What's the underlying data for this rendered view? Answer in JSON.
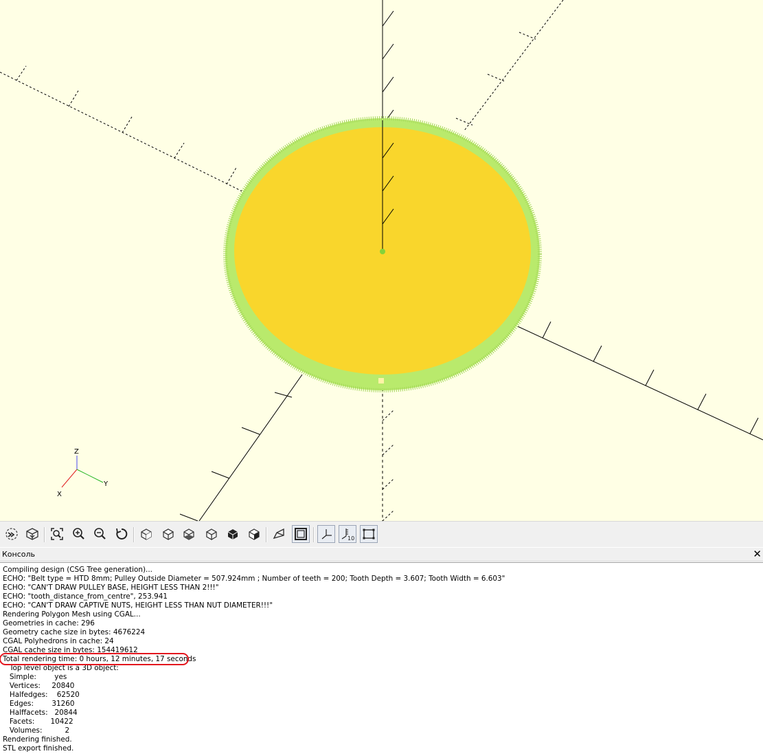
{
  "view": {
    "background": "#ffffe5",
    "model_top_color": "#f9d62c",
    "model_edge_color": "#b9ea6c",
    "axis_color": "#000000",
    "axes_gizmo": {
      "z_label": "Z",
      "y_label": "Y",
      "x_label": "X"
    }
  },
  "toolbar": {
    "buttons": [
      {
        "name": "preview-button",
        "icon": "preview-icon"
      },
      {
        "name": "render-button",
        "icon": "render-icon"
      },
      {
        "name": "view-all-button",
        "icon": "view-all-icon"
      },
      {
        "name": "zoom-in-button",
        "icon": "zoom-in-icon"
      },
      {
        "name": "zoom-out-button",
        "icon": "zoom-out-icon"
      },
      {
        "name": "reset-view-button",
        "icon": "reset-view-icon"
      },
      {
        "name": "view-right-button",
        "icon": "view-right-icon"
      },
      {
        "name": "view-top-button",
        "icon": "view-top-icon"
      },
      {
        "name": "view-bottom-button",
        "icon": "view-bottom-icon"
      },
      {
        "name": "view-left-button",
        "icon": "view-left-icon"
      },
      {
        "name": "view-front-button",
        "icon": "view-front-icon"
      },
      {
        "name": "view-back-button",
        "icon": "view-back-icon"
      },
      {
        "name": "perspective-button",
        "icon": "perspective-icon"
      },
      {
        "name": "orthogonal-button",
        "icon": "orthogonal-icon",
        "checked": true
      },
      {
        "name": "show-axes-button",
        "icon": "axes-icon",
        "checked": true
      },
      {
        "name": "show-scale-markers-button",
        "icon": "scale-markers-icon",
        "checked": true,
        "label": "10"
      },
      {
        "name": "show-edges-button",
        "icon": "edges-icon",
        "checked": true
      }
    ]
  },
  "console": {
    "title": "Консоль",
    "close_glyph": "✕",
    "lines": [
      "Compiling design (CSG Tree generation)...",
      "ECHO: \"Belt type = HTD 8mm; Pulley Outside Diameter = 507.924mm ; Number of teeth = 200; Tooth Depth = 3.607; Tooth Width = 6.603\"",
      "ECHO: \"CAN'T DRAW PULLEY BASE, HEIGHT LESS THAN 2!!!\"",
      "ECHO: \"tooth_distance_from_centre\", 253.941",
      "ECHO: \"CAN'T DRAW CAPTIVE NUTS, HEIGHT LESS THAN NUT DIAMETER!!!\"",
      "Rendering Polygon Mesh using CGAL...",
      "Geometries in cache: 296",
      "Geometry cache size in bytes: 4676224",
      "CGAL Polyhedrons in cache: 24",
      "CGAL cache size in bytes: 154419612",
      "Total rendering time: 0 hours, 12 minutes, 17 seconds",
      "   Top level object is a 3D object:",
      "   Simple:        yes",
      "   Vertices:     20840",
      "   Halfedges:    62520",
      "   Edges:        31260",
      "   Halffacets:   20844",
      "   Facets:       10422",
      "   Volumes:          2",
      "Rendering finished.",
      "STL export finished."
    ],
    "highlighted_line_index": 10,
    "highlight_color": "#e3161e"
  }
}
